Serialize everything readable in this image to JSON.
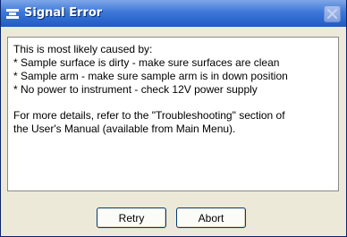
{
  "window": {
    "title": "Signal Error"
  },
  "message": {
    "lines": [
      "This is most likely caused by:",
      "* Sample surface is dirty - make sure surfaces are clean",
      "* Sample arm - make sure sample arm is in down position",
      "* No power to instrument - check 12V power supply",
      "For more details, refer to the \"Troubleshooting\" section of",
      "the User's Manual (available from Main Menu)."
    ]
  },
  "buttons": {
    "retry": "Retry",
    "abort": "Abort"
  },
  "icons": {
    "title": "app-window-icon",
    "close": "close-icon"
  },
  "colors": {
    "titlebar": "#3d78d8",
    "dialog_bg": "#ece9d8",
    "close_x": "#c8d4ee"
  }
}
